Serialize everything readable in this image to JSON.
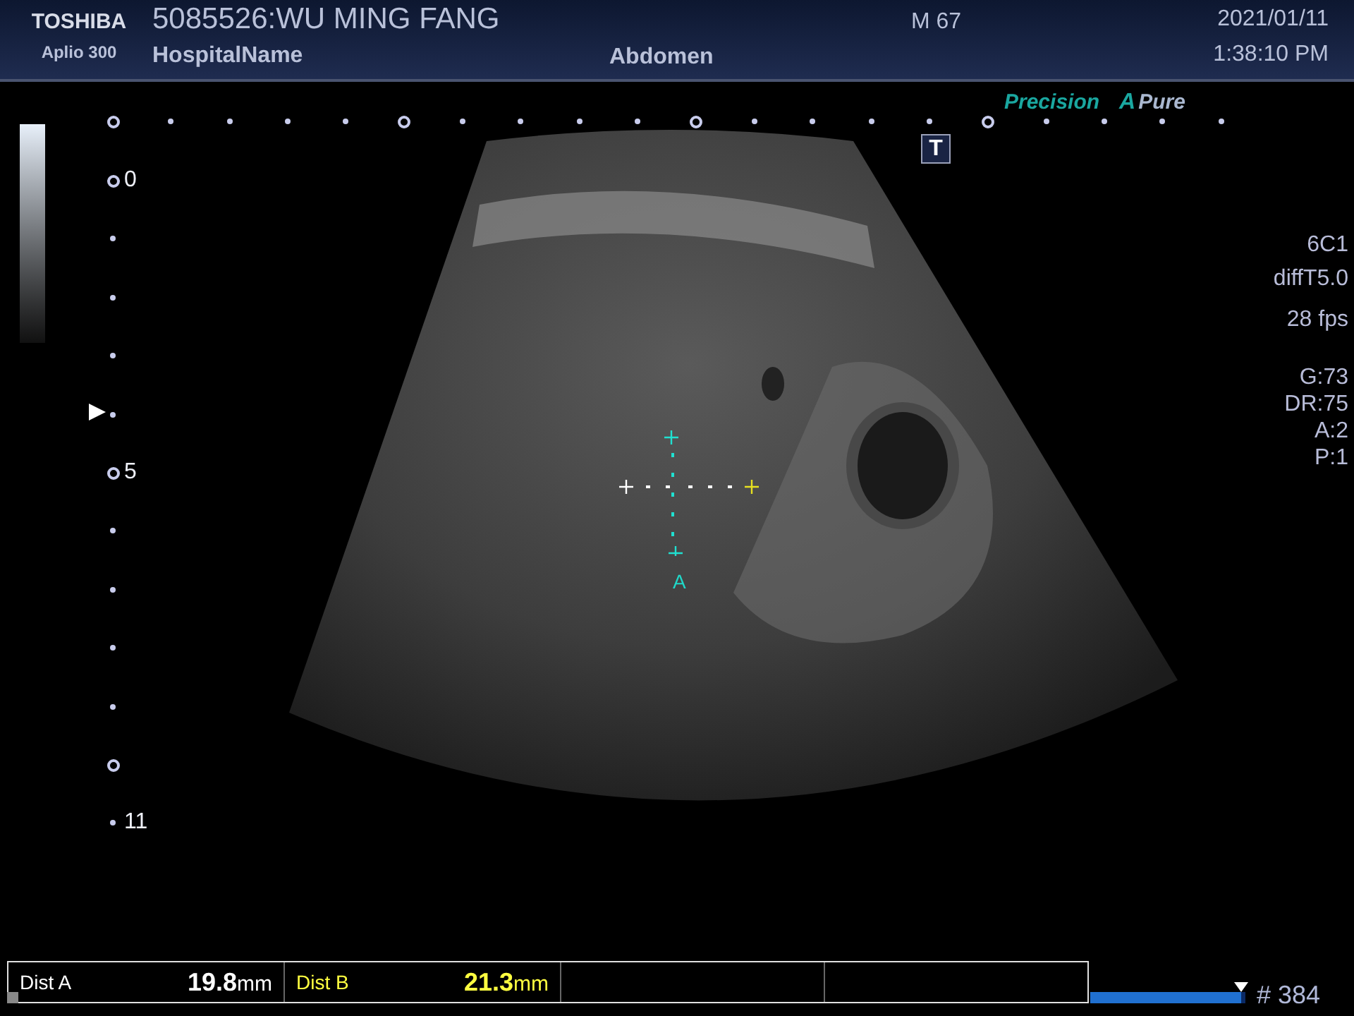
{
  "header": {
    "brand": "TOSHIBA",
    "model": "Aplio 300",
    "patient": "5085526:WU MING FANG",
    "hospital": "HospitalName",
    "sex_age": "M 67",
    "exam": "Abdomen",
    "date": "2021/01/11",
    "time": "1:38:10 PM"
  },
  "modes": {
    "precision": "Precision",
    "a_letter": "A",
    "pure": "Pure"
  },
  "t_button": "T",
  "depth_scale": {
    "labels": [
      "0",
      "5",
      "11"
    ]
  },
  "params": [
    [
      "6C1",
      "diffT5.0"
    ],
    [
      "28 fps"
    ],
    [
      "G:73",
      "DR:75",
      "A:2",
      "P:1"
    ]
  ],
  "caliper_label": "A",
  "measurements": [
    {
      "label": "Dist A",
      "value": "19.8",
      "unit": "mm",
      "color": "#ffffff"
    },
    {
      "label": "Dist B",
      "value": "21.3",
      "unit": "mm",
      "color": "#ffff40"
    }
  ],
  "cine": {
    "level": 0.97,
    "frame": "# 384"
  }
}
